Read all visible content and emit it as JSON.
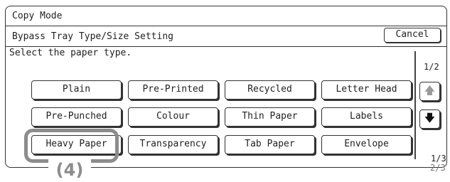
{
  "header": {
    "title": "Copy Mode"
  },
  "subheader": {
    "label": "Bypass Tray Type/Size Setting",
    "cancel_label": "Cancel"
  },
  "instruction": "Select the paper type.",
  "paper_types": [
    "Plain",
    "Pre-Printed",
    "Recycled",
    "Letter Head",
    "Pre-Punched",
    "Colour",
    "Thin Paper",
    "Labels",
    "Heavy Paper",
    "Transparency",
    "Tab Paper",
    "Envelope"
  ],
  "pager": {
    "current": "1/2",
    "bottom": "1/3",
    "ghost": "2/3"
  },
  "icons": {
    "scroll_up": "arrow-up-icon",
    "scroll_down": "arrow-down-icon"
  },
  "callout": {
    "label": "(4)"
  }
}
